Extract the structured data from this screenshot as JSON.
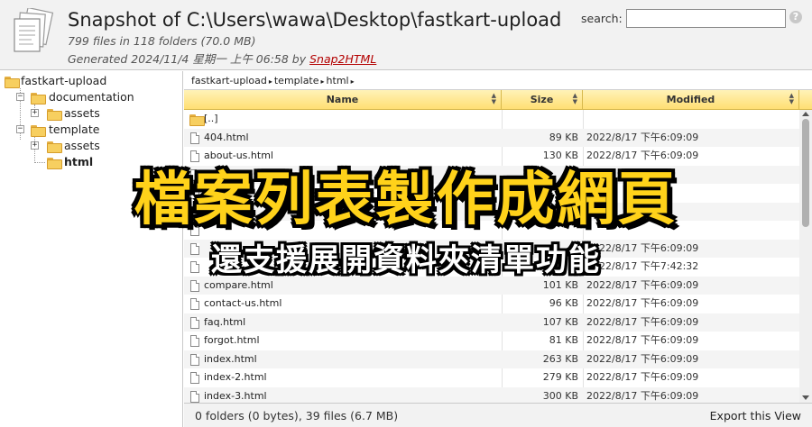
{
  "header": {
    "title": "Snapshot of C:\\Users\\wawa\\Desktop\\fastkart-upload",
    "stats": "799 files in 118 folders (70.0 MB)",
    "generated_prefix": "Generated 2024/11/4 星期一 上午 06:58 by ",
    "generator_link": "Snap2HTML",
    "search_label": "search:",
    "search_value": "",
    "help_icon": "?",
    "link_color": "#b30000"
  },
  "tree": {
    "root": "fastkart-upload",
    "items": [
      {
        "label": "documentation",
        "expander": "−"
      },
      {
        "label": "assets",
        "expander": "+"
      },
      {
        "label": "template",
        "expander": "−"
      },
      {
        "label": "assets",
        "expander": "+"
      },
      {
        "label": "html",
        "expander": ""
      }
    ]
  },
  "breadcrumb": {
    "parts": [
      "fastkart-upload",
      "template",
      "html"
    ],
    "separator": "▸"
  },
  "table": {
    "columns": [
      "Name",
      "Size",
      "Modified"
    ],
    "header_color": "#ffdf73",
    "parent_row": "[..]",
    "rows": [
      {
        "name": "404.html",
        "size": "89 KB",
        "modified": "2022/8/17 下午6:09:09"
      },
      {
        "name": "about-us.html",
        "size": "130 KB",
        "modified": "2022/8/17 下午6:09:09"
      },
      {
        "name": "",
        "size": "",
        "modified": ""
      },
      {
        "name": "",
        "size": "",
        "modified": ""
      },
      {
        "name": "",
        "size": "",
        "modified": ""
      },
      {
        "name": "",
        "size": "",
        "modified": ""
      },
      {
        "name": "",
        "size": "",
        "modified": "2022/8/17 下午6:09:09"
      },
      {
        "name": "",
        "size": "",
        "modified": "2022/8/17 下午7:42:32"
      },
      {
        "name": "compare.html",
        "size": "101 KB",
        "modified": "2022/8/17 下午6:09:09"
      },
      {
        "name": "contact-us.html",
        "size": "96 KB",
        "modified": "2022/8/17 下午6:09:09"
      },
      {
        "name": "faq.html",
        "size": "107 KB",
        "modified": "2022/8/17 下午6:09:09"
      },
      {
        "name": "forgot.html",
        "size": "81 KB",
        "modified": "2022/8/17 下午6:09:09"
      },
      {
        "name": "index.html",
        "size": "263 KB",
        "modified": "2022/8/17 下午6:09:09"
      },
      {
        "name": "index-2.html",
        "size": "279 KB",
        "modified": "2022/8/17 下午6:09:09"
      },
      {
        "name": "index-3.html",
        "size": "300 KB",
        "modified": "2022/8/17 下午6:09:09"
      }
    ]
  },
  "footer": {
    "summary": "0 folders (0 bytes), 39 files (6.7 MB)",
    "export": "Export this View"
  },
  "overlay": {
    "title": "檔案列表製作成網頁",
    "subtitle": "還支援展開資料夾清單功能",
    "title_color": "#ffd21a"
  }
}
